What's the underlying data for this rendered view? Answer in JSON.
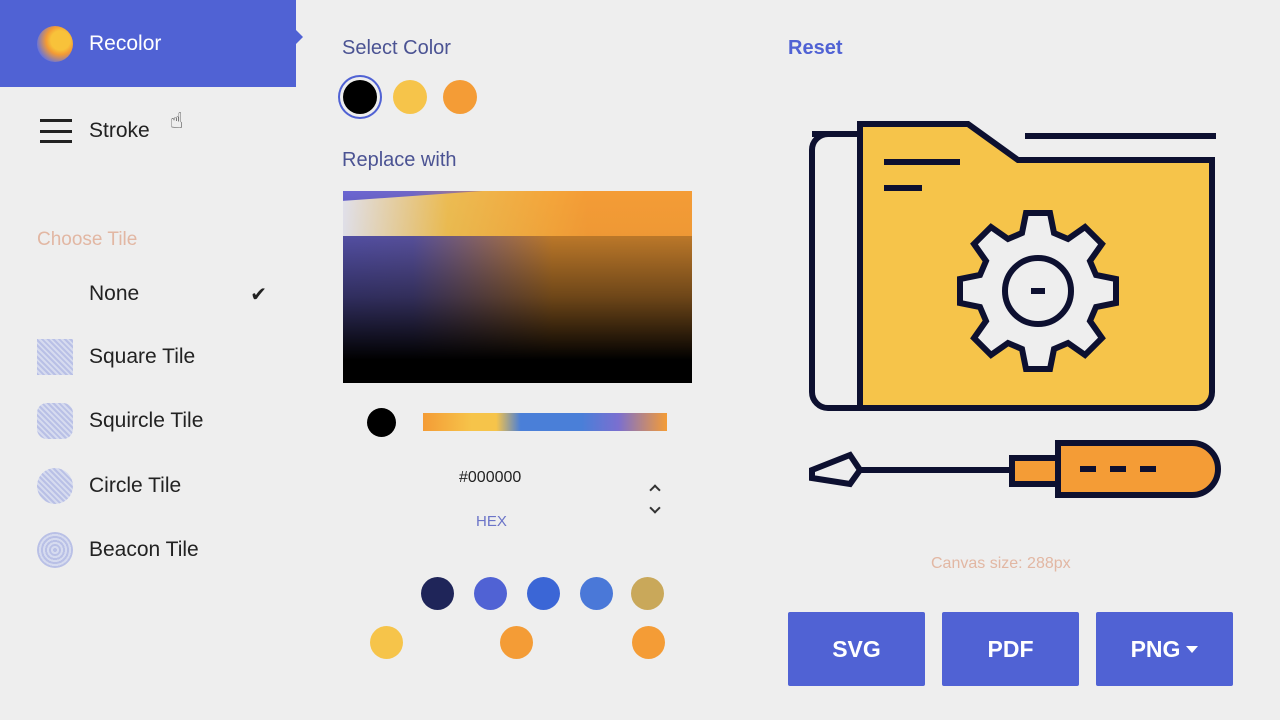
{
  "sidebar": {
    "recolor_label": "Recolor",
    "stroke_label": "Stroke",
    "choose_tile_label": "Choose Tile",
    "tiles": [
      {
        "label": "None",
        "selected": true
      },
      {
        "label": "Square Tile"
      },
      {
        "label": "Squircle Tile"
      },
      {
        "label": "Circle Tile"
      },
      {
        "label": "Beacon Tile"
      }
    ]
  },
  "editor": {
    "select_color_label": "Select Color",
    "selected_colors": [
      "#000000",
      "#f6c44a",
      "#f49c36"
    ],
    "replace_with_label": "Replace with",
    "hex_value": "#000000",
    "hex_label": "HEX",
    "palette": [
      "#1f2559",
      "#5062d4",
      "#3b66d6",
      "#4a78d8",
      "#c9a85a",
      "#f6c44a",
      "#f49c36",
      "#f49c36"
    ]
  },
  "preview": {
    "reset_label": "Reset",
    "canvas_size": "Canvas size: 288px",
    "exports": [
      "SVG",
      "PDF",
      "PNG"
    ]
  },
  "colors": {
    "accent": "#5062d4",
    "yellow": "#f6c44a",
    "orange": "#f49c36",
    "muted": "#e2b7a3"
  }
}
